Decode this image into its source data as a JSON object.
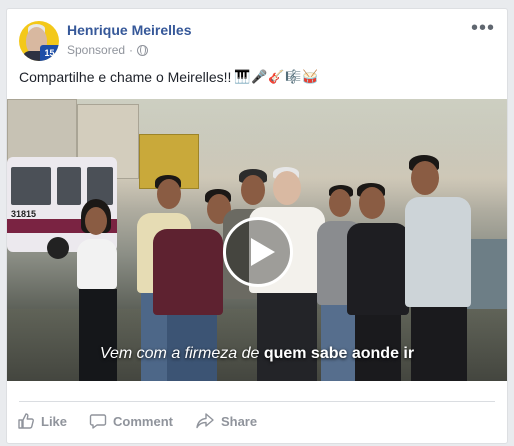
{
  "post": {
    "author": "Henrique Meirelles",
    "sponsored_label": "Sponsored",
    "sponsored_separator": "·",
    "avatar_badge": "15",
    "more_label": "•••",
    "message": "Compartilhe e chame o Meirelles!!",
    "message_emojis": [
      "piano-emoji",
      "microphone-emoji",
      "guitar-emoji",
      "musical-score-emoji",
      "drum-emoji"
    ],
    "video": {
      "caption_prefix": "Vem com a firmeza de ",
      "caption_bold": "quem sabe aonde ir",
      "bus_number": "31815"
    }
  },
  "actions": {
    "like": "Like",
    "comment": "Comment",
    "share": "Share"
  },
  "colors": {
    "link": "#365899",
    "muted": "#90949c",
    "badge_bg": "#1e4ea8",
    "avatar_bg": "#f3c81a"
  }
}
